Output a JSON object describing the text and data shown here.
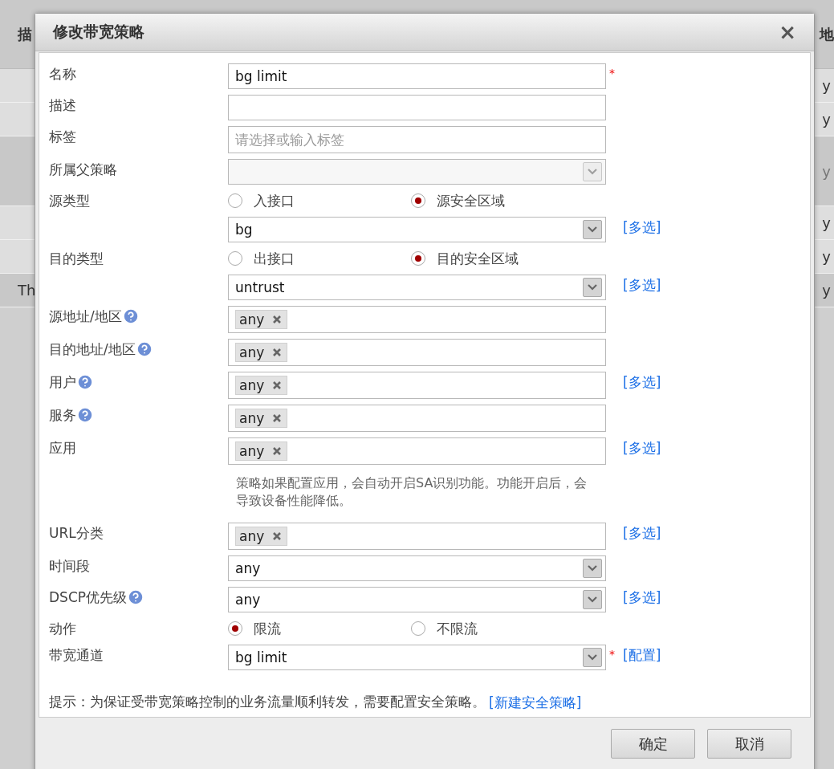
{
  "background": {
    "header": {
      "left": "描",
      "right": "地"
    },
    "rows": [
      {
        "right": "y",
        "disabled": false,
        "selected": false
      },
      {
        "right": "y",
        "disabled": false,
        "selected": false
      },
      {
        "right": "y",
        "disabled": true,
        "selected": true
      },
      {
        "right": "y",
        "disabled": false,
        "selected": false
      },
      {
        "right": "y",
        "disabled": false,
        "selected": false
      },
      {
        "left": "Th",
        "right": "y",
        "disabled": false,
        "selected": true
      }
    ]
  },
  "dialog": {
    "title": "修改带宽策略",
    "close": "×",
    "rows": [
      {
        "kind": "text",
        "label": "名称",
        "value": "bg limit",
        "required": "*"
      },
      {
        "kind": "text",
        "label": "描述"
      },
      {
        "kind": "text",
        "label": "标签",
        "placeholder": "请选择或输入标签"
      },
      {
        "kind": "select",
        "label": "所属父策略",
        "disabled": true
      },
      {
        "kind": "radio",
        "label": "源类型",
        "options": [
          {
            "label": "入接口",
            "selected": false
          },
          {
            "label": "源安全区域",
            "selected": true
          }
        ]
      },
      {
        "kind": "select",
        "value": "bg",
        "disabled": false,
        "link": "[多选]"
      },
      {
        "kind": "radio",
        "label": "目的类型",
        "options": [
          {
            "label": "出接口",
            "selected": false
          },
          {
            "label": "目的安全区域",
            "selected": true
          }
        ]
      },
      {
        "kind": "select",
        "value": "untrust",
        "disabled": false,
        "link": "[多选]"
      },
      {
        "kind": "tags",
        "label": "源地址/地区",
        "help": true,
        "tags": [
          "any"
        ]
      },
      {
        "kind": "tags",
        "label": "目的地址/地区",
        "help": true,
        "tags": [
          "any"
        ]
      },
      {
        "kind": "tags",
        "label": "用户",
        "help": true,
        "tags": [
          "any"
        ],
        "link": "[多选]"
      },
      {
        "kind": "tags",
        "label": "服务",
        "help": true,
        "tags": [
          "any"
        ]
      },
      {
        "kind": "tags",
        "label": "应用",
        "tags": [
          "any"
        ],
        "link": "[多选]"
      },
      {
        "kind": "note",
        "text": "策略如果配置应用，会自动开启SA识别功能。功能开启后，会导致设备性能降低。"
      },
      {
        "kind": "tags",
        "label": "URL分类",
        "tags": [
          "any"
        ],
        "link": "[多选]"
      },
      {
        "kind": "select",
        "label": "时间段",
        "value": "any",
        "disabled": false
      },
      {
        "kind": "select",
        "label": "DSCP优先级",
        "help": true,
        "value": "any",
        "disabled": false,
        "link": "[多选]"
      },
      {
        "kind": "radio",
        "label": "动作",
        "options": [
          {
            "label": "限流",
            "selected": true
          },
          {
            "label": "不限流",
            "selected": false
          }
        ]
      },
      {
        "kind": "select",
        "label": "带宽通道",
        "value": "bg limit",
        "disabled": false,
        "required": "*",
        "link": "[配置]"
      }
    ],
    "hint": {
      "text": "提示：为保证受带宽策略控制的业务流量顺利转发，需要配置安全策略。",
      "link": "[新建安全策略]"
    },
    "buttons": [
      "确定",
      "取消"
    ]
  }
}
